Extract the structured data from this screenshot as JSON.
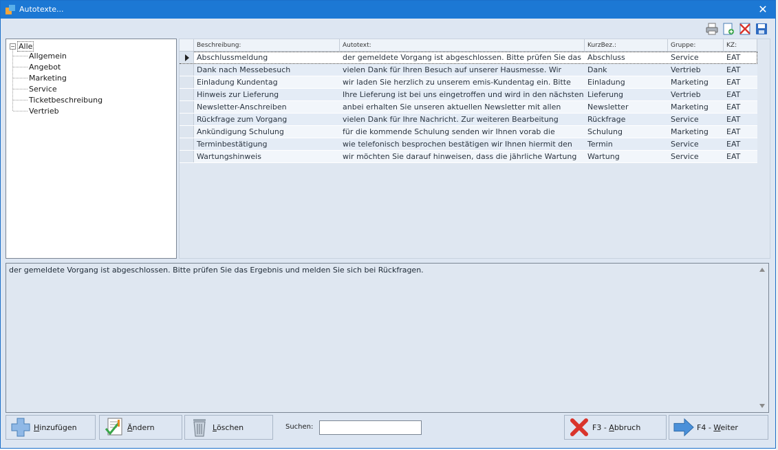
{
  "window": {
    "title": "Autotexte...",
    "close_glyph": "✕"
  },
  "toolbar": {
    "icons": [
      "printer-icon",
      "new-document-icon",
      "delete-x-icon",
      "save-disk-icon"
    ]
  },
  "tree": {
    "root": "Alle",
    "expander": "−",
    "items": [
      "Allgemein",
      "Angebot",
      "Marketing",
      "Service",
      "Ticketbeschreibung",
      "Vertrieb"
    ]
  },
  "grid": {
    "columns": [
      "Beschreibung:",
      "Autotext:",
      "KurzBez.:",
      "Gruppe:",
      "KZ:"
    ],
    "rows": [
      [
        "Abschlussmeldung",
        "der gemeldete Vorgang ist abgeschlossen. Bitte prüfen Sie das",
        "Abschluss",
        "Service",
        "EAT"
      ],
      [
        "Dank nach Messebesuch",
        "vielen Dank für Ihren Besuch auf unserer Hausmesse. Wir",
        "Dank",
        "Vertrieb",
        "EAT"
      ],
      [
        "Einladung Kundentag",
        "wir laden Sie herzlich zu unserem emis-Kundentag ein. Bitte",
        "Einladung",
        "Marketing",
        "EAT"
      ],
      [
        "Hinweis zur Lieferung",
        "Ihre Lieferung ist bei uns eingetroffen und wird in den nächsten",
        "Lieferung",
        "Vertrieb",
        "EAT"
      ],
      [
        "Newsletter-Anschreiben",
        "anbei erhalten Sie unseren aktuellen Newsletter mit allen",
        "Newsletter",
        "Marketing",
        "EAT"
      ],
      [
        "Rückfrage zum Vorgang",
        "vielen Dank für Ihre Nachricht. Zur weiteren Bearbeitung",
        "Rückfrage",
        "Service",
        "EAT"
      ],
      [
        "Ankündigung Schulung",
        "für die kommende Schulung senden wir Ihnen vorab die",
        "Schulung",
        "Marketing",
        "EAT"
      ],
      [
        "Terminbestätigung",
        "wie telefonisch besprochen bestätigen wir Ihnen hiermit den",
        "Termin",
        "Service",
        "EAT"
      ],
      [
        "Wartungshinweis",
        "wir möchten Sie darauf hinweisen, dass die jährliche Wartung",
        "Wartung",
        "Service",
        "EAT"
      ]
    ],
    "selected_row": 0
  },
  "preview": {
    "text": "der gemeldete Vorgang ist abgeschlossen. Bitte prüfen Sie das Ergebnis und melden Sie sich bei Rückfragen."
  },
  "buttons": {
    "add": {
      "mnemonic": "H",
      "rest": "inzufügen"
    },
    "edit": {
      "mnemonic": "Ä",
      "rest": "ndern"
    },
    "delete": {
      "mnemonic": "L",
      "rest": "öschen"
    },
    "cancel": {
      "prefix": "F3 - ",
      "mnemonic": "A",
      "rest": "bbruch"
    },
    "next": {
      "prefix": "F4 - ",
      "mnemonic": "W",
      "rest": "eiter"
    }
  },
  "search": {
    "label": "Suchen:",
    "value": ""
  },
  "colors": {
    "titlebar": "#1c78d4",
    "background": "#dde6f2",
    "accent_red": "#d9342b",
    "accent_blue": "#4a90d9"
  }
}
